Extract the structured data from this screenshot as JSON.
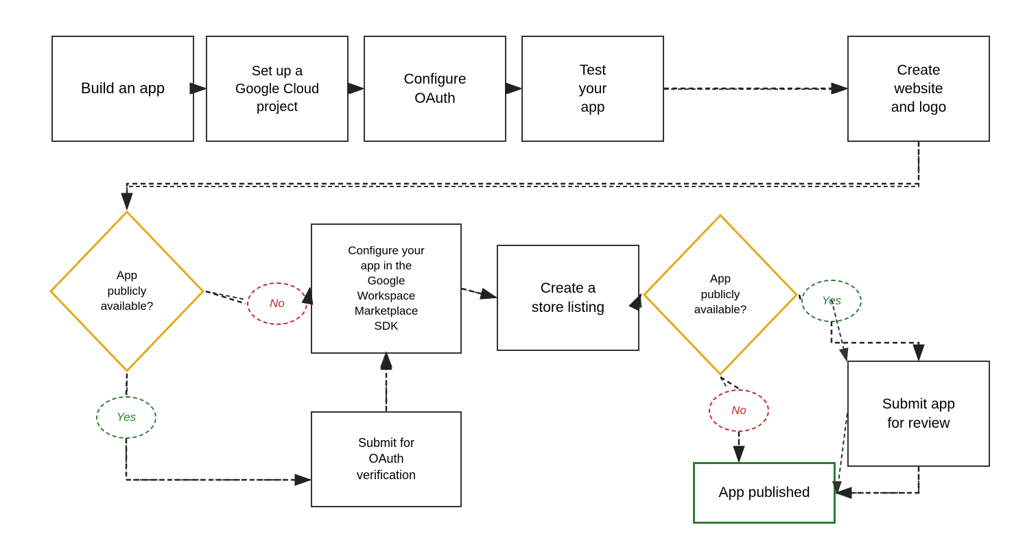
{
  "boxes": {
    "build_app": {
      "label": "Build\nan app"
    },
    "setup_google": {
      "label": "Set up a\nGoogle Cloud\nproject"
    },
    "configure_oauth": {
      "label": "Configure\nOAuth"
    },
    "test_app": {
      "label": "Test\nyour\napp"
    },
    "create_website": {
      "label": "Create\nwebsite\nand logo"
    },
    "configure_workspace": {
      "label": "Configure your\napp in the\nGoogle\nWorkspace\nMarketplace\nSDK"
    },
    "create_store": {
      "label": "Create a\nstore listing"
    },
    "submit_oauth": {
      "label": "Submit for\nOAuth\nverification"
    },
    "submit_review": {
      "label": "Submit app\nfor review"
    },
    "app_published": {
      "label": "App published"
    }
  },
  "diamonds": {
    "publicly_available_1": {
      "label": "App\npublicly\navailable?"
    },
    "publicly_available_2": {
      "label": "App\npublicly\navailable?"
    }
  },
  "ovals": {
    "no_1": {
      "label": "No"
    },
    "yes_1": {
      "label": "Yes"
    },
    "yes_2": {
      "label": "Yes"
    },
    "no_2": {
      "label": "No"
    }
  }
}
